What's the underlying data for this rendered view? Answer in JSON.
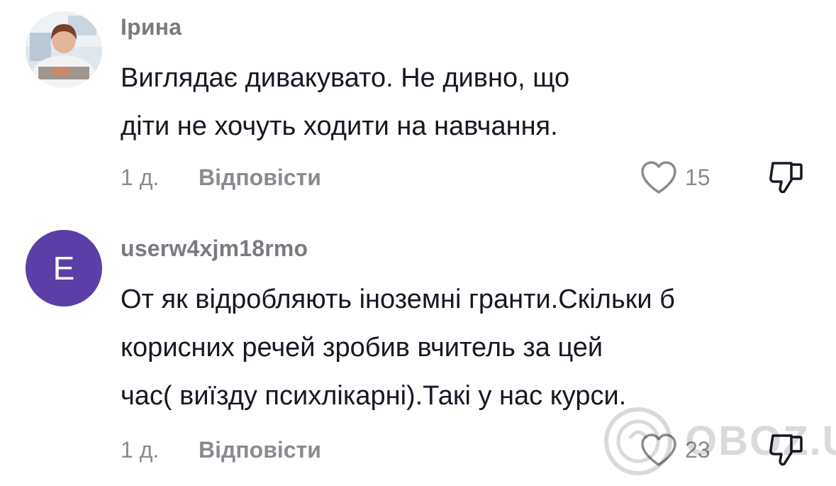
{
  "comments": [
    {
      "username": "Ірина",
      "avatar_type": "photo",
      "lines": [
        "Виглядає дивакувато. Не дивно, що",
        "діти не хочуть ходити на навчання."
      ],
      "time": "1 д.",
      "reply_label": "Відповісти",
      "likes": "15"
    },
    {
      "username": "userw4xjm18rmo",
      "avatar_type": "letter",
      "avatar_letter": "E",
      "avatar_color": "#5b3fa6",
      "lines": [
        "От як відробляють іноземні гранти.Скільки б",
        "корисних речей зробив вчитель за цей",
        "час( виїзду психлікарні).Такі у нас курси."
      ],
      "time": "1 д.",
      "reply_label": "Відповісти",
      "likes": "23"
    }
  ],
  "watermark": {
    "text": "OBOZ.UA"
  },
  "icons": {
    "like": "heart-outline-icon",
    "dislike": "thumbs-down-icon"
  }
}
